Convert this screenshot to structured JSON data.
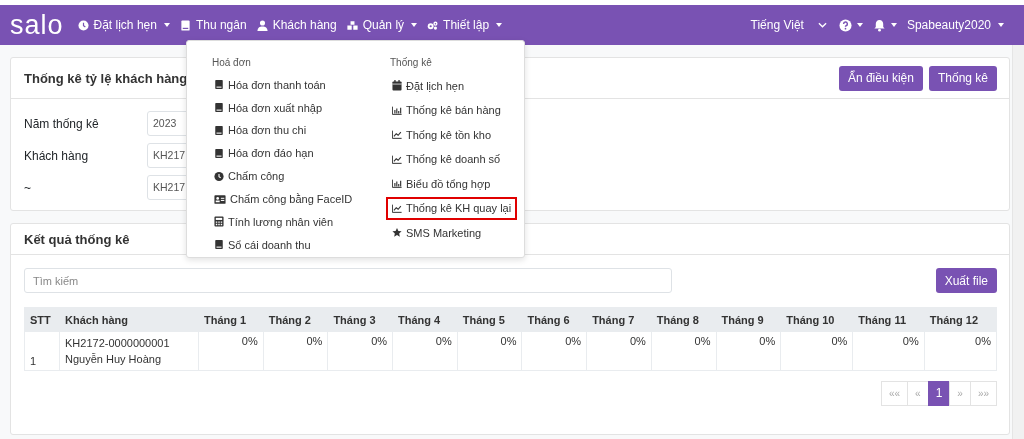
{
  "navbar": {
    "brand": "salo",
    "menu": [
      {
        "label": "Đặt lịch hẹn",
        "dropdown": true
      },
      {
        "label": "Thu ngân",
        "dropdown": false
      },
      {
        "label": "Khách hàng",
        "dropdown": false
      },
      {
        "label": "Quản lý",
        "dropdown": true
      },
      {
        "label": "Thiết lập",
        "dropdown": true
      }
    ],
    "language": "Tiếng Việt",
    "user": "Spabeauty2020"
  },
  "dropdown_menu": {
    "columns": [
      {
        "heading": "Hoá đơn",
        "items": [
          {
            "label": "Hóa đơn thanh toán",
            "highlighted": false
          },
          {
            "label": "Hóa đơn xuất nhập",
            "highlighted": false
          },
          {
            "label": "Hóa đơn thu chi",
            "highlighted": false
          },
          {
            "label": "Hóa đơn đáo hạn",
            "highlighted": false
          },
          {
            "label": "Chấm công",
            "highlighted": false
          },
          {
            "label": "Chấm công bằng FaceID",
            "highlighted": false
          },
          {
            "label": "Tính lương nhân viên",
            "highlighted": false
          },
          {
            "label": "Sổ cái doanh thu",
            "highlighted": false
          }
        ]
      },
      {
        "heading": "Thống kê",
        "items": [
          {
            "label": "Đặt lịch hẹn",
            "highlighted": false
          },
          {
            "label": "Thống kê bán hàng",
            "highlighted": false
          },
          {
            "label": "Thống kê tồn kho",
            "highlighted": false
          },
          {
            "label": "Thống kê doanh số",
            "highlighted": false
          },
          {
            "label": "Biểu đồ tổng hợp",
            "highlighted": false
          },
          {
            "label": "Thống kê KH quay lại",
            "highlighted": true
          },
          {
            "label": "SMS Marketing",
            "highlighted": false
          }
        ]
      }
    ]
  },
  "filter_card": {
    "title": "Thống kê tỷ lệ khách hàng",
    "buttons": [
      "Ẩn điều kiện",
      "Thống kê"
    ],
    "fields": [
      {
        "label": "Năm thống kê",
        "value": "2023"
      },
      {
        "label": "Khách hàng",
        "value": "KH217"
      },
      {
        "label": "~",
        "value": "KH217"
      }
    ]
  },
  "results_card": {
    "title": "Kết quả thống kê",
    "search": {
      "placeholder": "Tìm kiếm"
    },
    "export_button": "Xuất file",
    "table": {
      "columns": [
        "STT",
        "Khách hàng",
        "Tháng 1",
        "Tháng 2",
        "Tháng 3",
        "Tháng 4",
        "Tháng 5",
        "Tháng 6",
        "Tháng 7",
        "Tháng 8",
        "Tháng 9",
        "Tháng 10",
        "Tháng 11",
        "Tháng 12"
      ],
      "rows": [
        {
          "stt": "1",
          "customer_code": "KH2172-0000000001",
          "customer_name": "Nguyễn Huy Hoàng",
          "values": [
            "0%",
            "0%",
            "0%",
            "0%",
            "0%",
            "0%",
            "0%",
            "0%",
            "0%",
            "0%",
            "0%",
            "0%"
          ]
        }
      ]
    },
    "pagination": [
      {
        "label": "««",
        "selected": false
      },
      {
        "label": "«",
        "selected": false
      },
      {
        "label": "1",
        "selected": true
      },
      {
        "label": "»",
        "selected": false
      },
      {
        "label": "»»",
        "selected": false
      }
    ]
  }
}
